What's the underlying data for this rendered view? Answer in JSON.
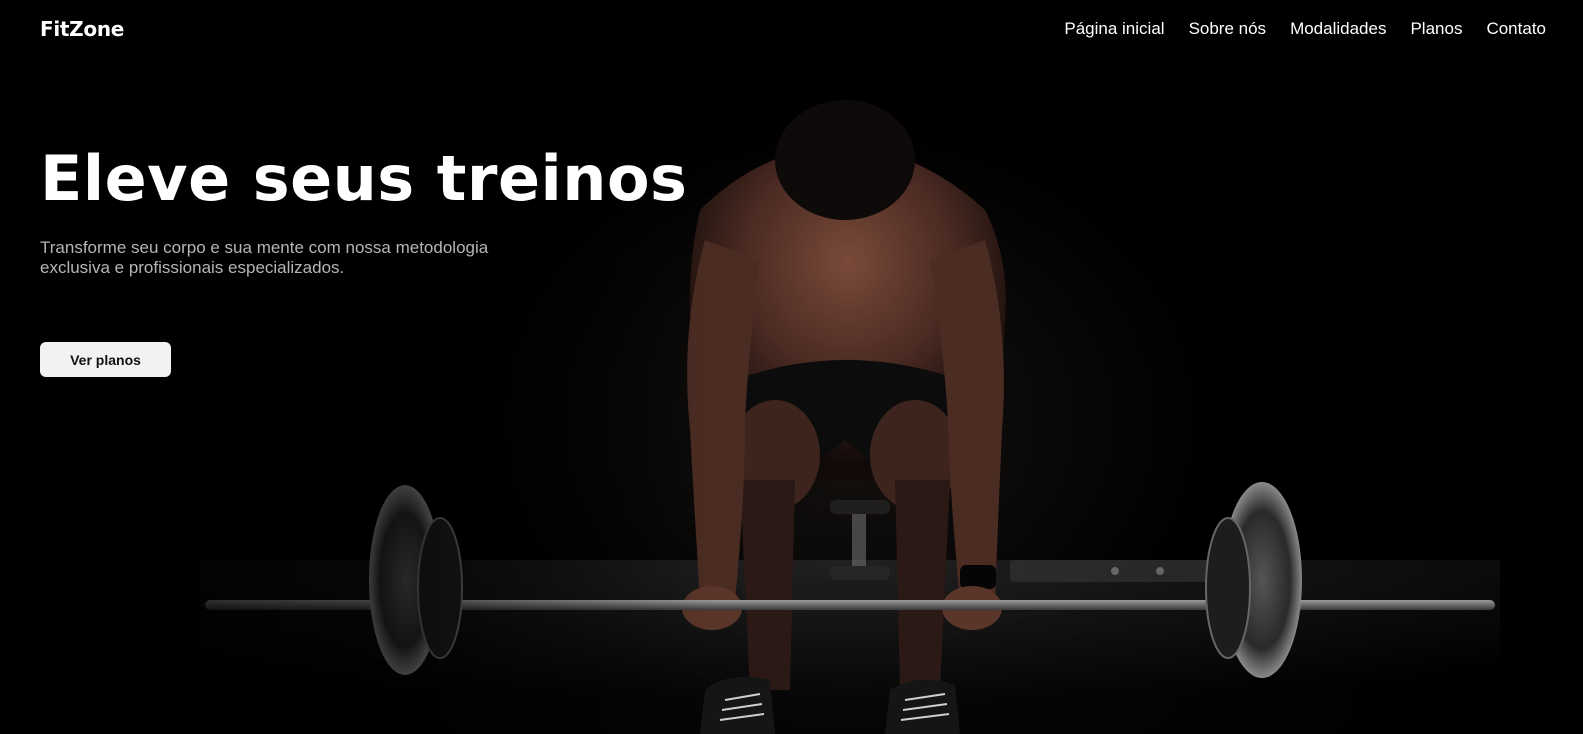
{
  "brand": {
    "name": "FitZone"
  },
  "nav": {
    "items": [
      {
        "label": "Página inicial"
      },
      {
        "label": "Sobre nós"
      },
      {
        "label": "Modalidades"
      },
      {
        "label": "Planos"
      },
      {
        "label": "Contato"
      }
    ]
  },
  "hero": {
    "title": "Eleve seus treinos",
    "subtitle": "Transforme seu corpo e sua mente com nossa metodologia exclusiva e profissionais especializados.",
    "cta_label": "Ver planos",
    "background_image": "athlete-deadlift-photo"
  },
  "colors": {
    "background": "#000000",
    "text": "#ffffff",
    "subtitle_text": "#b5b5b5",
    "button_bg": "#f2f2f2",
    "button_text": "#111111"
  }
}
